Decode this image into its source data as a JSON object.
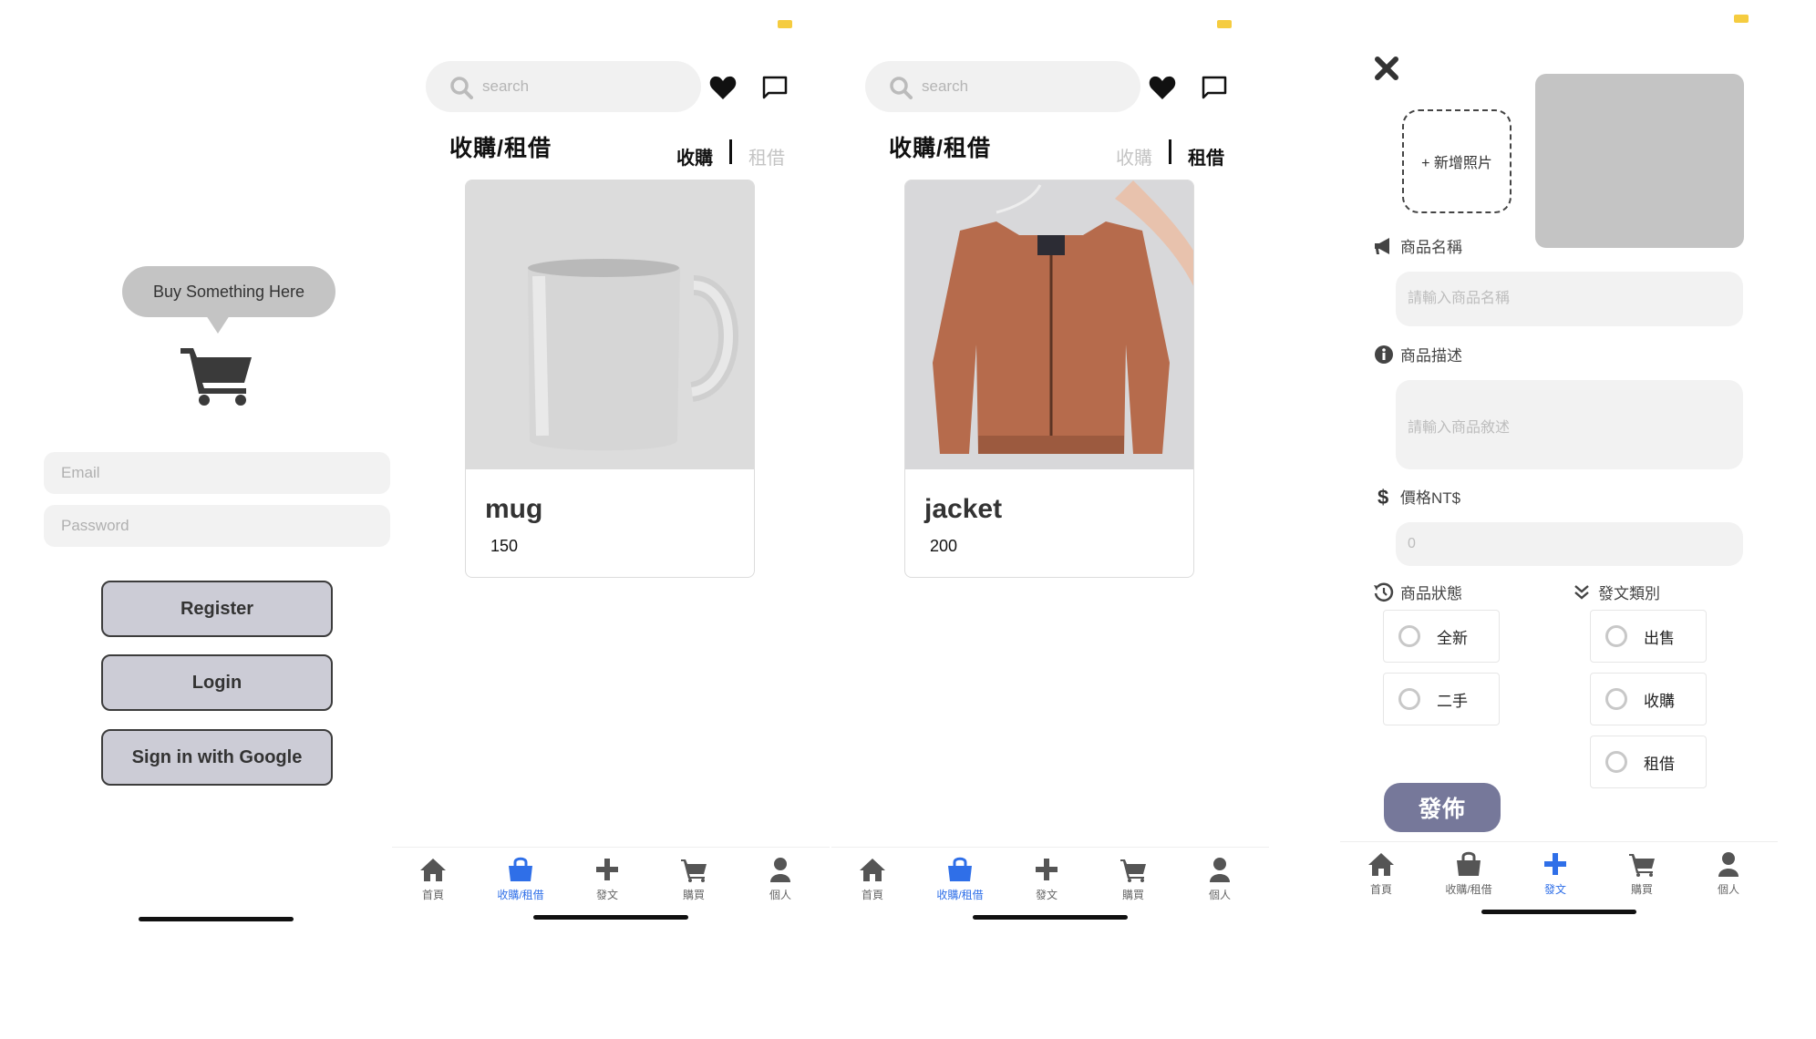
{
  "login": {
    "bubble_text": "Buy Something Here",
    "email_placeholder": "Email",
    "password_placeholder": "Password",
    "register_label": "Register",
    "login_label": "Login",
    "google_label": "Sign in with Google"
  },
  "list_buy": {
    "search_placeholder": "search",
    "title": "收購/租借",
    "seg_buy": "收購",
    "seg_rent": "租借",
    "active_segment": "收購",
    "item": {
      "name": "mug",
      "price": "150"
    }
  },
  "list_rent": {
    "search_placeholder": "search",
    "title": "收購/租借",
    "seg_buy": "收購",
    "seg_rent": "租借",
    "active_segment": "租借",
    "item": {
      "name": "jacket",
      "price": "200"
    }
  },
  "tabs": [
    {
      "label": "首頁",
      "icon": "home-icon"
    },
    {
      "label": "收購/租借",
      "icon": "shopping-bag-icon"
    },
    {
      "label": "發文",
      "icon": "plus-icon"
    },
    {
      "label": "購買",
      "icon": "cart-icon"
    },
    {
      "label": "個人",
      "icon": "user-icon"
    }
  ],
  "post": {
    "add_photo_label": "+ 新增照片",
    "name_label": "商品名稱",
    "name_placeholder": "請輸入商品名稱",
    "desc_label": "商品描述",
    "desc_placeholder": "請輸入商品敘述",
    "price_label": "價格NT$",
    "price_placeholder": "0",
    "condition_label": "商品狀態",
    "category_label": "發文類別",
    "conditions": [
      "全新",
      "二手"
    ],
    "categories": [
      "出售",
      "收購",
      "租借"
    ],
    "publish_label": "發佈"
  },
  "colors": {
    "accent_blue": "#2f6fe8",
    "button_gray": "#ccccd6",
    "publish_button": "#76789a",
    "battery_yellow": "#f5cc40"
  }
}
